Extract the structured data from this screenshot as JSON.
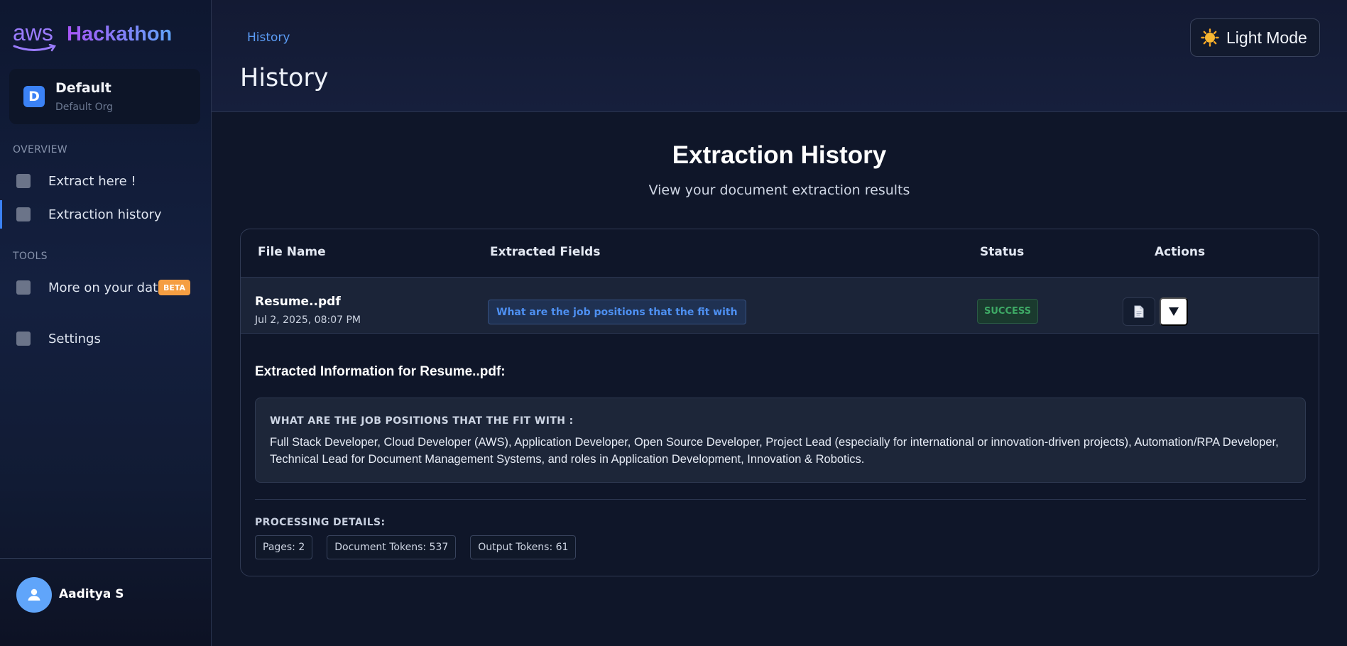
{
  "brand": {
    "logo_text": "aws",
    "title": "Hackathon"
  },
  "org": {
    "initial": "D",
    "name": "Default",
    "sub": "Default Org"
  },
  "sidebar": {
    "overview_label": "OVERVIEW",
    "tools_label": "TOOLS",
    "items": [
      {
        "label": "Extract here !"
      },
      {
        "label": "Extraction history"
      },
      {
        "label": "More on your data",
        "badge": "BETA"
      },
      {
        "label": "Settings"
      }
    ]
  },
  "user": {
    "name": "Aaditya S"
  },
  "header": {
    "breadcrumb": "History",
    "title": "History",
    "theme_button": "Light Mode"
  },
  "main": {
    "title": "Extraction History",
    "subtitle": "View your document extraction results",
    "columns": [
      "File Name",
      "Extracted Fields",
      "Status",
      "Actions"
    ],
    "row": {
      "file_name": "Resume..pdf",
      "date": "Jul 2, 2025, 08:07 PM",
      "field": "What are the job positions that the fit with",
      "status": "SUCCESS"
    },
    "details": {
      "title": "Extracted Information for Resume..pdf:",
      "question": "WHAT ARE THE JOB POSITIONS THAT THE FIT WITH :",
      "answer": "Full Stack Developer, Cloud Developer (AWS), Application Developer, Open Source Developer, Project Lead (especially for international or innovation-driven projects), Automation/RPA Developer, Technical Lead for Document Management Systems, and roles in Application Development, Innovation & Robotics.",
      "processing_label": "PROCESSING DETAILS:",
      "chips": [
        "Pages: 2",
        "Document Tokens: 537",
        "Output Tokens: 61"
      ]
    }
  },
  "colors": {
    "accent": "#3b82f6",
    "success": "#3eaa66",
    "beta": "#f59e42",
    "background": "#0f1629"
  },
  "icons": {
    "nav": "square-placeholder-icon",
    "theme": "sun-icon",
    "doc": "document-icon",
    "toggle": "triangle-down-icon",
    "user": "user-icon"
  }
}
